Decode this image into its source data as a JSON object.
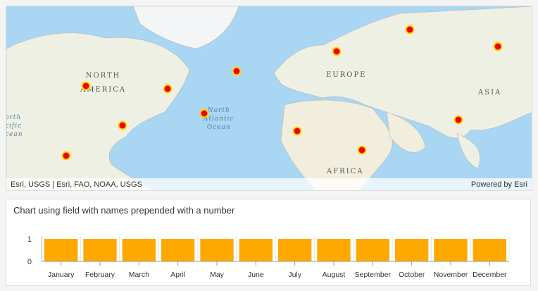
{
  "map": {
    "labels": {
      "north_america": [
        "NORTH",
        "AMERICA"
      ],
      "europe": "EUROPE",
      "asia": "ASIA",
      "africa": "AFRICA",
      "north_atlantic": [
        "North",
        "Atlantic",
        "Ocean"
      ],
      "north_pacific": [
        "orth",
        "cific",
        "cean"
      ]
    },
    "attribution": "Esri, USGS | Esri, FAO, NOAA, USGS",
    "powered_by": "Powered by Esri",
    "point_color": "#e60000",
    "point_count": 12
  },
  "chart_data": {
    "type": "bar",
    "title": "Chart using field with names prepended with a number",
    "categories": [
      "January",
      "February",
      "March",
      "April",
      "May",
      "June",
      "July",
      "August",
      "September",
      "October",
      "November",
      "December"
    ],
    "values": [
      1,
      1,
      1,
      1,
      1,
      1,
      1,
      1,
      1,
      1,
      1,
      1
    ],
    "ylim": [
      0,
      1
    ],
    "yticks": [
      "0",
      "1"
    ],
    "bar_color": "#ffa800",
    "xlabel": "",
    "ylabel": ""
  }
}
